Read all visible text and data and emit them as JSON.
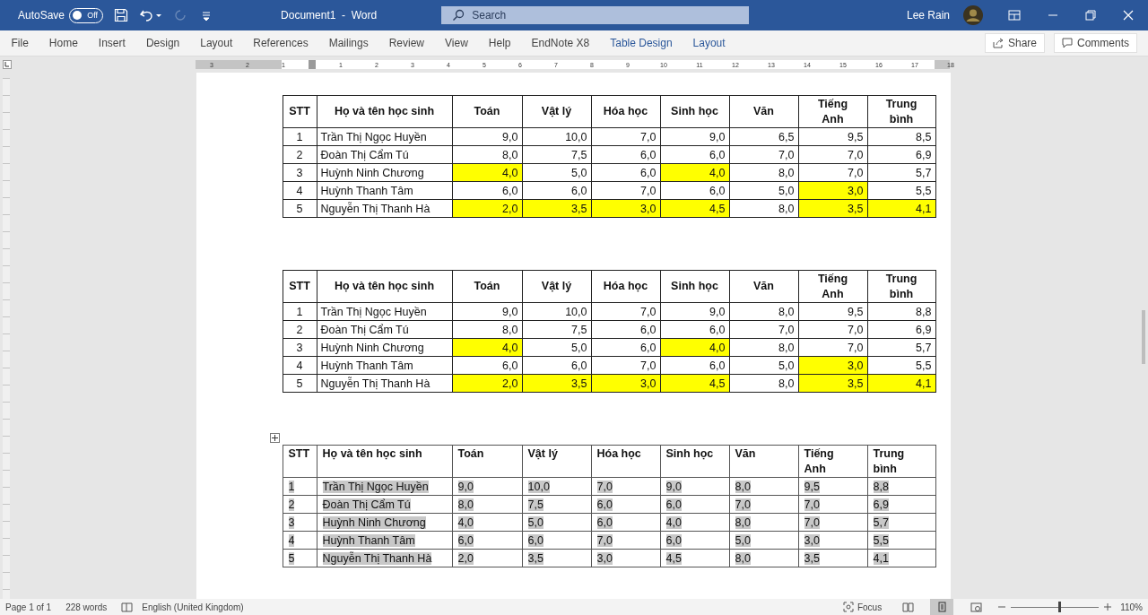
{
  "title_bar": {
    "autosave": {
      "label": "AutoSave",
      "on": false,
      "state_text": "Off"
    },
    "redo": {
      "disabled": true
    },
    "title": "Document1  -  Word",
    "search": {
      "placeholder": "Search"
    },
    "user": "Lee Rain"
  },
  "ribbon": {
    "tabs": [
      {
        "label": "File",
        "contextual": false
      },
      {
        "label": "Home",
        "contextual": false
      },
      {
        "label": "Insert",
        "contextual": false
      },
      {
        "label": "Design",
        "contextual": false
      },
      {
        "label": "Layout",
        "contextual": false
      },
      {
        "label": "References",
        "contextual": false
      },
      {
        "label": "Mailings",
        "contextual": false
      },
      {
        "label": "Review",
        "contextual": false
      },
      {
        "label": "View",
        "contextual": false
      },
      {
        "label": "Help",
        "contextual": false
      },
      {
        "label": "EndNote X8",
        "contextual": false
      },
      {
        "label": "Table Design",
        "contextual": true
      },
      {
        "label": "Layout",
        "contextual": true
      }
    ],
    "share": "Share",
    "comments": "Comments"
  },
  "ruler": {
    "labels": [
      "3",
      "2",
      "1",
      "1",
      "2",
      "3",
      "4",
      "5",
      "6",
      "7",
      "8",
      "9",
      "10",
      "11",
      "12",
      "13",
      "14",
      "15",
      "16",
      "17",
      "18"
    ]
  },
  "tables": [
    {
      "selected": false,
      "columns": [
        "STT",
        "Họ và tên học sinh",
        "Toán",
        "Vật lý",
        "Hóa học",
        "Sinh học",
        "Văn",
        "Tiếng\nAnh",
        "Trung\nbình"
      ],
      "rows": [
        {
          "cells": [
            {
              "text": "1",
              "highlighted": false
            },
            {
              "text": "Trần Thị Ngọc Huyền",
              "highlighted": false
            },
            {
              "text": "9,0",
              "highlighted": false
            },
            {
              "text": "10,0",
              "highlighted": false
            },
            {
              "text": "7,0",
              "highlighted": false
            },
            {
              "text": "9,0",
              "highlighted": false
            },
            {
              "text": "6,5",
              "highlighted": false
            },
            {
              "text": "9,5",
              "highlighted": false
            },
            {
              "text": "8,5",
              "highlighted": false
            }
          ]
        },
        {
          "cells": [
            {
              "text": "2",
              "highlighted": false
            },
            {
              "text": "Đoàn Thị Cẩm Tú",
              "highlighted": false
            },
            {
              "text": "8,0",
              "highlighted": false
            },
            {
              "text": "7,5",
              "highlighted": false
            },
            {
              "text": "6,0",
              "highlighted": false
            },
            {
              "text": "6,0",
              "highlighted": false
            },
            {
              "text": "7,0",
              "highlighted": false
            },
            {
              "text": "7,0",
              "highlighted": false
            },
            {
              "text": "6,9",
              "highlighted": false
            }
          ]
        },
        {
          "cells": [
            {
              "text": "3",
              "highlighted": false
            },
            {
              "text": "Huỳnh Ninh Chương",
              "highlighted": false
            },
            {
              "text": "4,0",
              "highlighted": true
            },
            {
              "text": "5,0",
              "highlighted": false
            },
            {
              "text": "6,0",
              "highlighted": false
            },
            {
              "text": "4,0",
              "highlighted": true
            },
            {
              "text": "8,0",
              "highlighted": false
            },
            {
              "text": "7,0",
              "highlighted": false
            },
            {
              "text": "5,7",
              "highlighted": false
            }
          ]
        },
        {
          "cells": [
            {
              "text": "4",
              "highlighted": false
            },
            {
              "text": "Huỳnh Thanh Tâm",
              "highlighted": false
            },
            {
              "text": "6,0",
              "highlighted": false
            },
            {
              "text": "6,0",
              "highlighted": false
            },
            {
              "text": "7,0",
              "highlighted": false
            },
            {
              "text": "6,0",
              "highlighted": false
            },
            {
              "text": "5,0",
              "highlighted": false
            },
            {
              "text": "3,0",
              "highlighted": true
            },
            {
              "text": "5,5",
              "highlighted": false
            }
          ]
        },
        {
          "cells": [
            {
              "text": "5",
              "highlighted": false
            },
            {
              "text": "Nguyễn Thị Thanh Hà",
              "highlighted": false
            },
            {
              "text": "2,0",
              "highlighted": true
            },
            {
              "text": "3,5",
              "highlighted": true
            },
            {
              "text": "3,0",
              "highlighted": true
            },
            {
              "text": "4,5",
              "highlighted": true
            },
            {
              "text": "8,0",
              "highlighted": false
            },
            {
              "text": "3,5",
              "highlighted": true
            },
            {
              "text": "4,1",
              "highlighted": true
            }
          ]
        }
      ]
    },
    {
      "selected": false,
      "columns": [
        "STT",
        "Họ và tên học sinh",
        "Toán",
        "Vật lý",
        "Hóa học",
        "Sinh học",
        "Văn",
        "Tiếng\nAnh",
        "Trung\nbình"
      ],
      "rows": [
        {
          "cells": [
            {
              "text": "1",
              "highlighted": false
            },
            {
              "text": "Trần Thị Ngọc Huyền",
              "highlighted": false
            },
            {
              "text": "9,0",
              "highlighted": false
            },
            {
              "text": "10,0",
              "highlighted": false
            },
            {
              "text": "7,0",
              "highlighted": false
            },
            {
              "text": "9,0",
              "highlighted": false
            },
            {
              "text": "8,0",
              "highlighted": false
            },
            {
              "text": "9,5",
              "highlighted": false
            },
            {
              "text": "8,8",
              "highlighted": false
            }
          ]
        },
        {
          "cells": [
            {
              "text": "2",
              "highlighted": false
            },
            {
              "text": "Đoàn Thị Cẩm Tú",
              "highlighted": false
            },
            {
              "text": "8,0",
              "highlighted": false
            },
            {
              "text": "7,5",
              "highlighted": false
            },
            {
              "text": "6,0",
              "highlighted": false
            },
            {
              "text": "6,0",
              "highlighted": false
            },
            {
              "text": "7,0",
              "highlighted": false
            },
            {
              "text": "7,0",
              "highlighted": false
            },
            {
              "text": "6,9",
              "highlighted": false
            }
          ]
        },
        {
          "cells": [
            {
              "text": "3",
              "highlighted": false
            },
            {
              "text": "Huỳnh Ninh Chương",
              "highlighted": false
            },
            {
              "text": "4,0",
              "highlighted": true
            },
            {
              "text": "5,0",
              "highlighted": false
            },
            {
              "text": "6,0",
              "highlighted": false
            },
            {
              "text": "4,0",
              "highlighted": true
            },
            {
              "text": "8,0",
              "highlighted": false
            },
            {
              "text": "7,0",
              "highlighted": false
            },
            {
              "text": "5,7",
              "highlighted": false
            }
          ]
        },
        {
          "cells": [
            {
              "text": "4",
              "highlighted": false
            },
            {
              "text": "Huỳnh Thanh Tâm",
              "highlighted": false
            },
            {
              "text": "6,0",
              "highlighted": false
            },
            {
              "text": "6,0",
              "highlighted": false
            },
            {
              "text": "7,0",
              "highlighted": false
            },
            {
              "text": "6,0",
              "highlighted": false
            },
            {
              "text": "5,0",
              "highlighted": false
            },
            {
              "text": "3,0",
              "highlighted": true
            },
            {
              "text": "5,5",
              "highlighted": false
            }
          ]
        },
        {
          "cells": [
            {
              "text": "5",
              "highlighted": false
            },
            {
              "text": "Nguyễn Thị Thanh Hà",
              "highlighted": false
            },
            {
              "text": "2,0",
              "highlighted": true
            },
            {
              "text": "3,5",
              "highlighted": true
            },
            {
              "text": "3,0",
              "highlighted": true
            },
            {
              "text": "4,5",
              "highlighted": true
            },
            {
              "text": "8,0",
              "highlighted": false
            },
            {
              "text": "3,5",
              "highlighted": true
            },
            {
              "text": "4,1",
              "highlighted": true
            }
          ]
        }
      ]
    },
    {
      "selected": true,
      "columns": [
        "STT",
        "Họ và tên học sinh",
        "Toán",
        "Vật lý",
        "Hóa học",
        "Sinh học",
        "Văn",
        "Tiếng\nAnh",
        "Trung\nbình"
      ],
      "rows": [
        {
          "cells": [
            {
              "text": "1",
              "highlighted": false
            },
            {
              "text": "Trần Thị Ngọc Huyền",
              "highlighted": false
            },
            {
              "text": "9,0",
              "highlighted": false
            },
            {
              "text": "10,0",
              "highlighted": false
            },
            {
              "text": "7,0",
              "highlighted": false
            },
            {
              "text": "9,0",
              "highlighted": false
            },
            {
              "text": "8,0",
              "highlighted": false
            },
            {
              "text": "9,5",
              "highlighted": false
            },
            {
              "text": "8,8",
              "highlighted": false
            }
          ]
        },
        {
          "cells": [
            {
              "text": "2",
              "highlighted": false
            },
            {
              "text": "Đoàn Thị Cẩm Tú",
              "highlighted": false
            },
            {
              "text": "8,0",
              "highlighted": false
            },
            {
              "text": "7,5",
              "highlighted": false
            },
            {
              "text": "6,0",
              "highlighted": false
            },
            {
              "text": "6,0",
              "highlighted": false
            },
            {
              "text": "7,0",
              "highlighted": false
            },
            {
              "text": "7,0",
              "highlighted": false
            },
            {
              "text": "6,9",
              "highlighted": false
            }
          ]
        },
        {
          "cells": [
            {
              "text": "3",
              "highlighted": false
            },
            {
              "text": "Huỳnh Ninh Chương",
              "highlighted": false
            },
            {
              "text": "4,0",
              "highlighted": false
            },
            {
              "text": "5,0",
              "highlighted": false
            },
            {
              "text": "6,0",
              "highlighted": false
            },
            {
              "text": "4,0",
              "highlighted": false
            },
            {
              "text": "8,0",
              "highlighted": false
            },
            {
              "text": "7,0",
              "highlighted": false
            },
            {
              "text": "5,7",
              "highlighted": false
            }
          ]
        },
        {
          "cells": [
            {
              "text": "4",
              "highlighted": false
            },
            {
              "text": "Huỳnh Thanh Tâm",
              "highlighted": false
            },
            {
              "text": "6,0",
              "highlighted": false
            },
            {
              "text": "6,0",
              "highlighted": false
            },
            {
              "text": "7,0",
              "highlighted": false
            },
            {
              "text": "6,0",
              "highlighted": false
            },
            {
              "text": "5,0",
              "highlighted": false
            },
            {
              "text": "3,0",
              "highlighted": false
            },
            {
              "text": "5,5",
              "highlighted": false
            }
          ]
        },
        {
          "cells": [
            {
              "text": "5",
              "highlighted": false
            },
            {
              "text": "Nguyễn Thị Thanh Hà",
              "highlighted": false
            },
            {
              "text": "2,0",
              "highlighted": false
            },
            {
              "text": "3,5",
              "highlighted": false
            },
            {
              "text": "3,0",
              "highlighted": false
            },
            {
              "text": "4,5",
              "highlighted": false
            },
            {
              "text": "8,0",
              "highlighted": false
            },
            {
              "text": "3,5",
              "highlighted": false
            },
            {
              "text": "4,1",
              "highlighted": false
            }
          ]
        }
      ]
    }
  ],
  "status_bar": {
    "page": "Page 1 of 1",
    "words": "228 words",
    "language": "English (United Kingdom)",
    "focus": "Focus",
    "views": [
      {
        "kind": "read",
        "selected": false
      },
      {
        "kind": "print",
        "selected": true
      },
      {
        "kind": "web",
        "selected": false
      }
    ],
    "zoom": {
      "level": 0.55,
      "reading": "110%"
    }
  }
}
